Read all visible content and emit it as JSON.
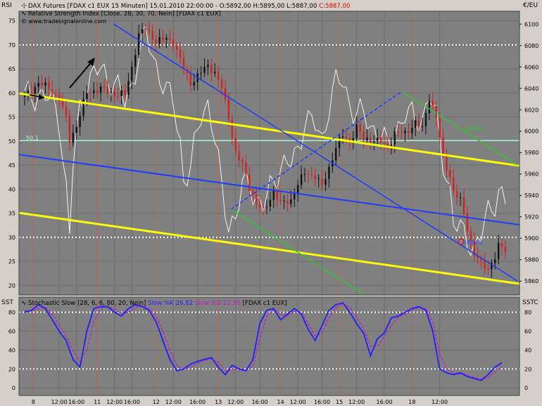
{
  "colors": {
    "frame": "#d4d0c8",
    "plot_bg": "#808080",
    "grid": "#6e6e6e",
    "vgrid": "#b06a5a",
    "candle_up": "#111111",
    "candle_down": "#d42020",
    "rsi_line": "#f2f2f2",
    "yellow": "#ffff00",
    "blue": "#1f3cff",
    "green": "#33c233",
    "cyan": "#a8f5d8",
    "dots": "#ffffff",
    "slow_k": "#1f1fff",
    "slow_d": "#c21cc2",
    "close_red": "#e00000"
  },
  "header": {
    "left_axis_label": "RSI",
    "right_axis_label": "€/EU",
    "line1_prefix": "DAX Futures [FDAX c1 EUX  15 Minuten] 15.01.2010 22:00:00 - O:5892,00 H:5895,00 L:5887,00 ",
    "line1_close": "C:5887,00",
    "line2": "Relative Strength Index [Close, 28, 30, 70, Nein]    [FDAX c1 EUX]",
    "line3": "© www.tradesignalonline.com"
  },
  "annotations": {
    "rsi_level_label": "50,1",
    "price_label": "5889,4",
    "green_label": "5998,5"
  },
  "lower": {
    "left_axis_label": "SST",
    "right_axis_label": "SSTC",
    "legend_prefix": "Stochastic Slow [28, 6, 6, 80, 20, Nein]",
    "legend_k": "Slow %K 26,82",
    "legend_d": "Slow %D 22,85",
    "legend_suffix": "[FDAX c1 EUX]"
  },
  "chart_data": [
    {
      "type": "candlestick",
      "title": "DAX Futures [FDAX c1 EUX  15 Minuten]",
      "instrument": "FDAX c1 EUX",
      "interval": "15 Minuten",
      "last_bar": {
        "time": "15.01.2010 22:00:00",
        "open": 5892.0,
        "high": 5895.0,
        "low": 5887.0,
        "close": 5887.0
      },
      "price_ylim": [
        5847,
        6112
      ],
      "price_ticks": [
        5860,
        5880,
        5900,
        5920,
        5940,
        5960,
        5980,
        6000,
        6020,
        6040,
        6060,
        6080,
        6100
      ],
      "rsi_ylim": [
        18,
        77
      ],
      "rsi_ticks": [
        20,
        25,
        30,
        35,
        40,
        45,
        50,
        55,
        60,
        65,
        70,
        75
      ],
      "rsi_levels": [
        30,
        70
      ],
      "rsi_marked_value": 50.1,
      "x_tick_labels": [
        "8",
        "12:00",
        "16:00",
        "11",
        "12:00",
        "16:00",
        "12",
        "12:00",
        "16:00",
        "13",
        "12:00",
        "16:00",
        "14",
        "12:00",
        "16:00",
        "15",
        "12:00",
        "16:00",
        "18",
        "12:00"
      ],
      "x_day_labels": [
        "8",
        "11",
        "12",
        "13",
        "14",
        "15",
        "18"
      ],
      "price_path": [
        [
          0,
          6032
        ],
        [
          4,
          6045
        ],
        [
          7,
          6040
        ],
        [
          10,
          6030
        ],
        [
          12,
          6012
        ],
        [
          13,
          5992
        ],
        [
          15,
          6005
        ],
        [
          18,
          6036
        ],
        [
          22,
          6040
        ],
        [
          26,
          6035
        ],
        [
          29,
          6034
        ],
        [
          31,
          6060
        ],
        [
          33,
          6090
        ],
        [
          35,
          6096
        ],
        [
          38,
          6084
        ],
        [
          41,
          6086
        ],
        [
          43,
          6084
        ],
        [
          46,
          6058
        ],
        [
          48,
          6045
        ],
        [
          51,
          6055
        ],
        [
          53,
          6061
        ],
        [
          55,
          6055
        ],
        [
          57,
          6040
        ],
        [
          59,
          6013
        ],
        [
          61,
          5980
        ],
        [
          63,
          5968
        ],
        [
          65,
          5948
        ],
        [
          67,
          5933
        ],
        [
          69,
          5925
        ],
        [
          72,
          5944
        ],
        [
          74,
          5932
        ],
        [
          77,
          5936
        ],
        [
          79,
          5950
        ],
        [
          81,
          5961
        ],
        [
          84,
          5958
        ],
        [
          86,
          5948
        ],
        [
          88,
          5966
        ],
        [
          90,
          5985
        ],
        [
          92,
          5996
        ],
        [
          94,
          5990
        ],
        [
          96,
          6004
        ],
        [
          98,
          5992
        ],
        [
          100,
          5993
        ],
        [
          103,
          5990
        ],
        [
          105,
          5985
        ],
        [
          107,
          5998
        ],
        [
          110,
          5998
        ],
        [
          113,
          6008
        ],
        [
          115,
          6002
        ],
        [
          117,
          6032
        ],
        [
          119,
          6012
        ],
        [
          121,
          5975
        ],
        [
          123,
          5958
        ],
        [
          124,
          5943
        ],
        [
          126,
          5935
        ],
        [
          128,
          5910
        ],
        [
          130,
          5885
        ],
        [
          132,
          5876
        ],
        [
          134,
          5872
        ],
        [
          136,
          5882
        ],
        [
          137,
          5892
        ],
        [
          139,
          5890
        ]
      ],
      "rsi_path": [
        [
          0,
          59
        ],
        [
          4,
          60
        ],
        [
          8,
          58
        ],
        [
          10,
          55
        ],
        [
          12,
          40
        ],
        [
          13,
          30
        ],
        [
          14,
          45
        ],
        [
          16,
          57
        ],
        [
          18,
          62
        ],
        [
          22,
          65
        ],
        [
          26,
          62
        ],
        [
          29,
          58
        ],
        [
          31,
          62
        ],
        [
          33,
          68
        ],
        [
          35,
          72
        ],
        [
          38,
          66
        ],
        [
          41,
          60
        ],
        [
          43,
          58
        ],
        [
          45,
          50
        ],
        [
          46,
          42
        ],
        [
          48,
          44
        ],
        [
          51,
          56
        ],
        [
          53,
          58
        ],
        [
          55,
          50
        ],
        [
          57,
          40
        ],
        [
          59,
          33
        ],
        [
          61,
          34
        ],
        [
          63,
          40
        ],
        [
          65,
          42
        ],
        [
          67,
          38
        ],
        [
          69,
          36
        ],
        [
          72,
          42
        ],
        [
          74,
          45
        ],
        [
          77,
          45
        ],
        [
          79,
          48
        ],
        [
          81,
          55
        ],
        [
          84,
          53
        ],
        [
          86,
          50
        ],
        [
          88,
          58
        ],
        [
          90,
          62
        ],
        [
          92,
          62
        ],
        [
          94,
          58
        ],
        [
          96,
          56
        ],
        [
          98,
          55
        ],
        [
          100,
          53
        ],
        [
          103,
          52
        ],
        [
          105,
          48
        ],
        [
          107,
          52
        ],
        [
          110,
          56
        ],
        [
          113,
          54
        ],
        [
          115,
          55
        ],
        [
          117,
          60
        ],
        [
          119,
          54
        ],
        [
          121,
          46
        ],
        [
          123,
          40
        ],
        [
          124,
          33
        ],
        [
          126,
          31
        ],
        [
          128,
          30
        ],
        [
          130,
          28
        ],
        [
          132,
          30
        ],
        [
          134,
          35
        ],
        [
          136,
          38
        ],
        [
          137,
          40
        ],
        [
          139,
          37
        ]
      ]
    },
    {
      "type": "line",
      "title": "Stochastic Slow [28, 6, 6, 80, 20, Nein]",
      "ylim": [
        -8,
        96
      ],
      "y_ticks": [
        0,
        20,
        40,
        60,
        80
      ],
      "levels": [
        20,
        80
      ],
      "series": [
        {
          "name": "Slow %K 26,82",
          "x": [
            0,
            2,
            4,
            6,
            8,
            10,
            12,
            14,
            16,
            18,
            20,
            22,
            24,
            26,
            28,
            30,
            32,
            34,
            36,
            38,
            40,
            42,
            44,
            46,
            48,
            50,
            52,
            54,
            56,
            58,
            60,
            62,
            64,
            66,
            68,
            70,
            72,
            74,
            76,
            78,
            80,
            82,
            84,
            86,
            88,
            90,
            92,
            94,
            96,
            98,
            100,
            102,
            104,
            106,
            108,
            110,
            112,
            114,
            116,
            118,
            120,
            122,
            124,
            126,
            128,
            130,
            132,
            134,
            136,
            138
          ],
          "values": [
            80,
            82,
            88,
            84,
            72,
            60,
            50,
            30,
            22,
            60,
            84,
            86,
            86,
            80,
            76,
            84,
            88,
            86,
            82,
            70,
            50,
            30,
            18,
            20,
            25,
            28,
            30,
            32,
            22,
            14,
            24,
            20,
            18,
            30,
            68,
            82,
            84,
            72,
            78,
            84,
            78,
            62,
            50,
            66,
            82,
            88,
            90,
            80,
            68,
            58,
            34,
            52,
            58,
            74,
            76,
            80,
            84,
            86,
            82,
            60,
            20,
            16,
            14,
            16,
            12,
            10,
            8,
            14,
            22,
            26.82
          ]
        },
        {
          "name": "Slow %D 22,85",
          "x": [
            0,
            2,
            4,
            6,
            8,
            10,
            12,
            14,
            16,
            18,
            20,
            22,
            24,
            26,
            28,
            30,
            32,
            34,
            36,
            38,
            40,
            42,
            44,
            46,
            48,
            50,
            52,
            54,
            56,
            58,
            60,
            62,
            64,
            66,
            68,
            70,
            72,
            74,
            76,
            78,
            80,
            82,
            84,
            86,
            88,
            90,
            92,
            94,
            96,
            98,
            100,
            102,
            104,
            106,
            108,
            110,
            112,
            114,
            116,
            118,
            120,
            122,
            124,
            126,
            128,
            130,
            132,
            134,
            136,
            138
          ],
          "values": [
            82,
            81,
            84,
            85,
            78,
            66,
            55,
            40,
            28,
            40,
            70,
            84,
            86,
            83,
            79,
            80,
            85,
            87,
            84,
            76,
            60,
            40,
            24,
            19,
            22,
            26,
            29,
            31,
            27,
            18,
            19,
            21,
            19,
            23,
            52,
            76,
            83,
            78,
            76,
            81,
            80,
            68,
            55,
            58,
            74,
            85,
            89,
            85,
            74,
            63,
            44,
            44,
            54,
            66,
            75,
            78,
            82,
            85,
            84,
            70,
            36,
            20,
            16,
            15,
            14,
            11,
            9,
            11,
            17,
            22.85
          ]
        }
      ]
    }
  ]
}
